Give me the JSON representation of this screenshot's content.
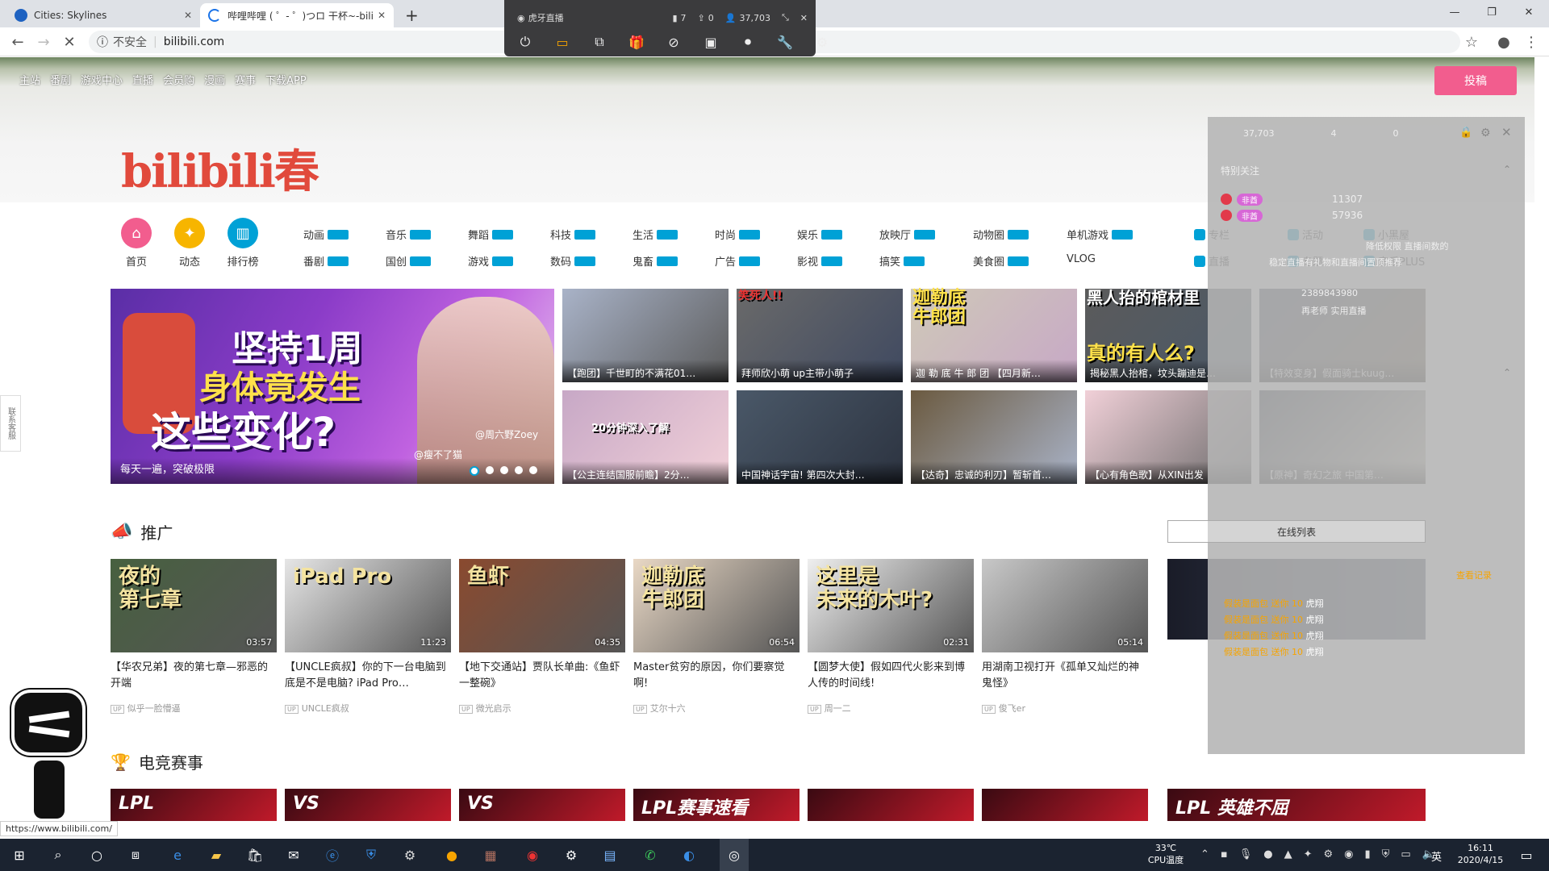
{
  "browser": {
    "tabs": [
      {
        "title": "Cities: Skylines"
      },
      {
        "title": "哔哩哔哩 ( ゜- ゜)つロ 干杯~-bili"
      }
    ],
    "security_label": "不安全",
    "url": "bilibili.com",
    "status_url": "https://www.bilibili.com/"
  },
  "huya": {
    "title": "虎牙直播",
    "count1": "7",
    "count2": "0",
    "viewers": "37,703"
  },
  "bili": {
    "topnav": [
      "主站",
      "番剧",
      "游戏中心",
      "直播",
      "会员购",
      "漫画",
      "赛事",
      "下载APP"
    ],
    "upload_label": "投稿",
    "logo_text": "bilibili春",
    "quick": [
      {
        "label": "首页",
        "color": "#f25d8e"
      },
      {
        "label": "动态",
        "color": "#f7b500"
      },
      {
        "label": "排行榜",
        "color": "#00a1d6"
      }
    ],
    "channels_row1": [
      "动画",
      "音乐",
      "舞蹈",
      "科技",
      "生活",
      "时尚",
      "娱乐",
      "放映厅",
      "动物圈",
      "单机游戏"
    ],
    "channels_row2": [
      "番剧",
      "国创",
      "游戏",
      "数码",
      "鬼畜",
      "广告",
      "影视",
      "搞笑",
      "美食圈",
      "VLOG"
    ],
    "extra_row1": [
      "专栏",
      "活动",
      "小黑屋"
    ],
    "extra_row2": [
      "直播",
      "专题",
      "音乐PLUS"
    ],
    "carousel": {
      "headline1": "坚持1周",
      "headline2": "身体竟发生",
      "headline3": "这些变化?",
      "caption": "每天一遍，突破极限",
      "tags": [
        "@周六野Zoey",
        "@瘦不了猫"
      ]
    },
    "featured": [
      "【跑团】千世町的不满花01…",
      "拜师欣小萌 up主带小萌子",
      "迦 勒 底 牛 郎 团 【四月新…",
      "揭秘黑人抬棺，坟头蹦迪是…",
      "【特效变身】假面骑士kuug…",
      "【公主连结国服前瞻】2分…",
      "中国神话宇宙! 第四次大封…",
      "【达奇】忠诚的利刃】暂斩首…",
      "【心有角色歌】从XIN出发",
      "【原神】奇幻之旅 中国第…"
    ],
    "featured_overlay": [
      "笑死人!!",
      "迦勒底\n牛郎团",
      "黑人抬的棺材里",
      "真的有人么?",
      "20分钟深入了解"
    ],
    "promo_title": "推广",
    "promo": [
      {
        "title": "【华农兄弟】夜的第七章—邪恶的开端",
        "up": "似乎一脸懵逼",
        "dur": "03:57",
        "overlay": "夜的\n第七章"
      },
      {
        "title": "【UNCLE疯叔】你的下一台电脑到底是不是电脑? iPad Pro…",
        "up": "UNCLE疯叔",
        "dur": "11:23",
        "overlay": "iPad Pro"
      },
      {
        "title": "【地下交通站】贾队长单曲:《鱼虾一整碗》",
        "up": "微光启示",
        "dur": "04:35",
        "overlay": "鱼虾"
      },
      {
        "title": "Master贫穷的原因，你们要察觉啊!",
        "up": "艾尔十六",
        "dur": "06:54",
        "overlay": "迦勒底\n牛郎团"
      },
      {
        "title": "【圆梦大使】假如四代火影来到博人传的时间线!",
        "up": "周一二",
        "dur": "02:31",
        "overlay": "这里是\n未来的木叶?"
      },
      {
        "title": "用湖南卫视打开《孤单又灿烂的神 鬼怪》",
        "up": "俊飞er",
        "dur": "05:14",
        "overlay": ""
      }
    ],
    "esports_title": "电竞赛事",
    "esports_thumbs": [
      "LPL",
      "VS",
      "VS",
      "LPL赛事速看",
      "",
      "",
      "LPL 英雄不屈"
    ]
  },
  "panel": {
    "stats": [
      "37,703",
      "4",
      "0"
    ],
    "special_follow": "特别关注",
    "ids": [
      "11307",
      "57936"
    ],
    "msgs": [
      "降低权限 直播间数的",
      "稳定直播有礼物和直播间置顶推荐",
      "2389843980",
      "再老师 实用直播"
    ],
    "online_list": "在线列表",
    "recharge": "查看记录",
    "gift_list": [
      "假装是面包 送你 10",
      "假装是面包 送你 10",
      "假装是面包 送你 10",
      "假装是面包 送你 10"
    ],
    "gift_name": "虎翔"
  },
  "taskbar": {
    "temp": "33℃",
    "cpu_label": "CPU温度",
    "time": "16:11",
    "date": "2020/4/15",
    "lang": "英"
  }
}
